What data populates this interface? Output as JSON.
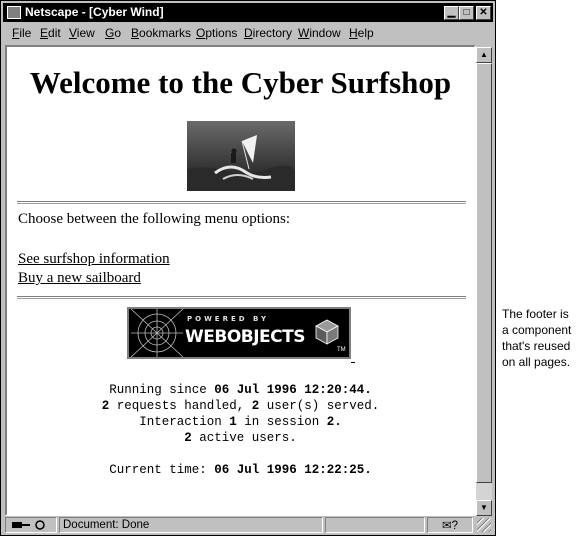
{
  "window": {
    "title": "Netscape - [Cyber Wind]",
    "buttons": {
      "minimize": "▁",
      "maximize": "□",
      "close": "✕"
    }
  },
  "menu": {
    "items": [
      "File",
      "Edit",
      "View",
      "Go",
      "Bookmarks",
      "Options",
      "Directory",
      "Window",
      "Help"
    ]
  },
  "page": {
    "heading": "Welcome to the Cyber Surfshop",
    "prompt": "Choose between the following menu options:",
    "links": [
      "See surfshop information",
      "Buy a new sailboard"
    ],
    "logo": {
      "powered_by": "POWERED BY",
      "brand": "WEBOBJECTS",
      "tm": "TM"
    },
    "footer": {
      "line1_pre": "Running since ",
      "line1_val": "06 Jul 1996 12:20:44.",
      "line2_n1": "2",
      "line2_mid": " requests handled, ",
      "line2_n2": "2",
      "line2_post": " user(s) served.",
      "line3_pre": "Interaction ",
      "line3_n1": "1",
      "line3_mid": " in session ",
      "line3_n2": "2.",
      "line4_n": "2",
      "line4_post": " active users.",
      "line5_pre": "Current time: ",
      "line5_val": "06 Jul 1996 12:22:25."
    }
  },
  "status": {
    "text": "Document: Done"
  },
  "annotation": "The footer is\na component\nthat's reused\non all pages."
}
